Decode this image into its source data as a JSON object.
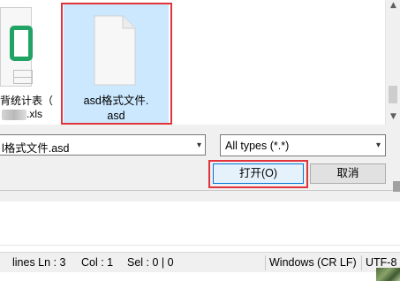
{
  "file_list": {
    "items": [
      {
        "name_line1": "背统计表（",
        "name_line2": ".xls",
        "icon": "excel-file-icon"
      },
      {
        "name_line1": "asd格式文件.",
        "name_line2": "asd",
        "icon": "blank-file-icon",
        "selected": true
      }
    ]
  },
  "filename_field": {
    "value": "l格式文件.asd"
  },
  "file_type_select": {
    "selected": "All types (*.*)"
  },
  "buttons": {
    "open": "打开(O)",
    "cancel": "取消"
  },
  "statusbar": {
    "lines": "lines Ln : 3",
    "col": "Col : 1",
    "sel": "Sel : 0 | 0",
    "eol": "Windows (CR LF)",
    "encoding": "UTF-8"
  },
  "colors": {
    "selection_bg": "#cce8ff",
    "annotation_red": "#e0343a",
    "excel_green": "#21a366",
    "open_button_border": "#0078d7"
  }
}
